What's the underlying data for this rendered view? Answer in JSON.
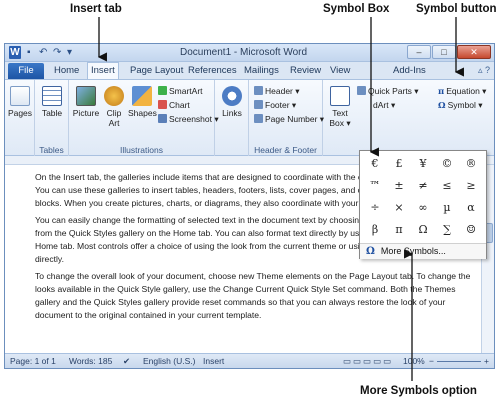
{
  "callouts": {
    "insert_tab": "Insert tab",
    "symbol_box": "Symbol Box",
    "symbol_button": "Symbol button",
    "more_symbols_option": "More Symbols option"
  },
  "window": {
    "title": "Document1 - Microsoft Word",
    "min": "–",
    "max": "□",
    "close": "✕"
  },
  "tabs": {
    "file": "File",
    "items": [
      "Home",
      "Insert",
      "Page Layout",
      "References",
      "Mailings",
      "Review",
      "View",
      "Add-Ins"
    ],
    "active": "Insert"
  },
  "ribbon": {
    "pages": "Pages",
    "table": "Table",
    "tables_group": "Tables",
    "picture": "Picture",
    "clip_art": "Clip Art",
    "shapes": "Shapes",
    "smartart": "SmartArt",
    "chart": "Chart",
    "screenshot": "Screenshot ▾",
    "illustrations_group": "Illustrations",
    "links": "Links",
    "header": "Header ▾",
    "footer": "Footer ▾",
    "page_number": "Page Number ▾",
    "header_footer_group": "Header & Footer",
    "text_box": "Text Box ▾",
    "quick_parts": "Quick Parts ▾",
    "wordart": "dArt ▾",
    "equation": "Equation ▾",
    "symbol": "Symbol ▾"
  },
  "document": {
    "paragraphs": [
      "On the Insert tab, the galleries include items that are designed to coordinate with the overall look of your document. You can use these galleries to insert tables, headers, footers, lists, cover pages, and other document building blocks. When you create pictures, charts, or diagrams, they also coordinate with your current document look.",
      "You can easily change the formatting of selected text in the document text by choosing a look for the selected text from the Quick Styles gallery on the Home tab. You can also format text directly by using the other controls on the Home tab. Most controls offer a choice of using the look from the current theme or using a format that you specify directly.",
      "To change the overall look of your document, choose new Theme elements on the Page Layout tab. To change the looks available in the Quick Style gallery, use the Change Current Quick Style Set command. Both the Themes gallery and the Quick Styles gallery provide reset commands so that you can always restore the look of your document to the original contained in your current template."
    ]
  },
  "symbol_box": {
    "symbols": [
      "€",
      "£",
      "¥",
      "©",
      "®",
      "™",
      "±",
      "≠",
      "≤",
      "≥",
      "÷",
      "×",
      "∞",
      "µ",
      "α",
      "β",
      "π",
      "Ω",
      "∑",
      "☺"
    ],
    "more_symbols": "More Symbols..."
  },
  "status": {
    "page": "Page: 1 of 1",
    "words": "Words: 185",
    "language": "English (U.S.)",
    "mode": "Insert",
    "zoom": "100%"
  },
  "colors": {
    "file_tab": "#1d55a5",
    "ribbon_bg": "#dfe9f6",
    "omega_icon": "#1e4fa0"
  }
}
